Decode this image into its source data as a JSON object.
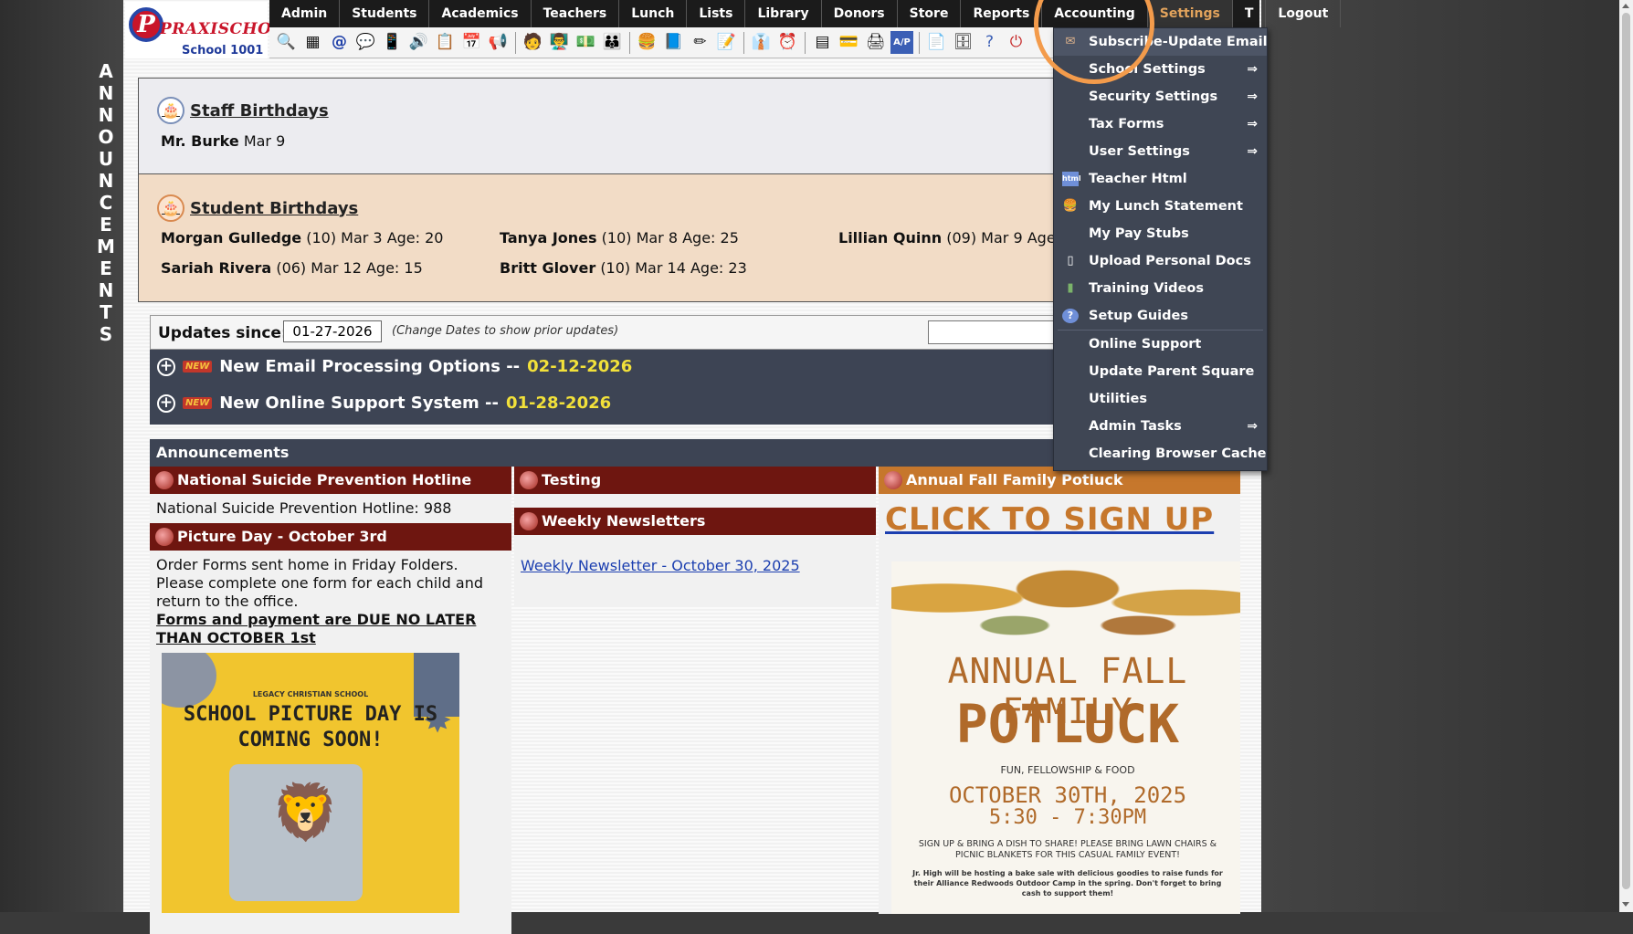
{
  "sidebar_vertical": "ANNOUNCEMENTS",
  "logo": {
    "brand": "PRAXISCHOOL",
    "letter": "P",
    "tm": "™",
    "school": "School 1001"
  },
  "nav": [
    "Admin",
    "Students",
    "Academics",
    "Teachers",
    "Lunch",
    "Lists",
    "Library",
    "Donors",
    "Store",
    "Reports",
    "Accounting",
    "Settings",
    "T",
    "Logout"
  ],
  "toolbar_icons": [
    "magnifier-icon",
    "grid-icon",
    "email-icon",
    "chat-icon",
    "phone-icon",
    "speaker-icon",
    "form-icon",
    "calendar-icon",
    "megaphone-icon",
    "person-icon",
    "teacher-icon",
    "money-icon",
    "parents-icon",
    "lunch-icon",
    "book-icon",
    "pencil-icon",
    "notes-icon",
    "staff-icon",
    "clock-icon",
    "table-icon",
    "card-icon",
    "printer-icon",
    "ap-icon",
    "pdf-icon",
    "server-icon",
    "help-icon",
    "power-icon"
  ],
  "staff_birthdays": {
    "title": "Staff Birthdays",
    "entries": [
      {
        "name": "Mr. Burke",
        "detail": "Mar 9"
      }
    ]
  },
  "student_birthdays": {
    "title": "Student Birthdays",
    "entries": [
      {
        "name": "Morgan Gulledge",
        "detail": "(10) Mar 3 Age: 20"
      },
      {
        "name": "Tanya Jones",
        "detail": "(10) Mar 8 Age: 25"
      },
      {
        "name": "Lillian Quinn",
        "detail": "(09) Mar 9 Age:"
      },
      {
        "name": "Sariah Rivera",
        "detail": "(06) Mar 12 Age: 15"
      },
      {
        "name": "Britt Glover",
        "detail": "(10) Mar 14 Age: 23"
      }
    ]
  },
  "updates": {
    "label": "Updates since:",
    "date": "01-27-2026",
    "hint": "(Change Dates to show prior updates)",
    "new_badge": "NEW",
    "items": [
      {
        "title": "New Email Processing Options --",
        "date": "02-12-2026"
      },
      {
        "title": "New Online Support System --",
        "date": "01-28-2026"
      }
    ]
  },
  "announcements": {
    "header": "Announcements",
    "hotline": {
      "title": "National Suicide Prevention Hotline",
      "body": "National Suicide Prevention Hotline: 988"
    },
    "picture_day": {
      "title": "Picture Day - October 3rd",
      "body": "Order Forms sent home in Friday Folders. Please complete one form for each child and return to the office.",
      "due": "Forms and payment are DUE NO LATER THAN OCTOBER 1st",
      "poster_school": "LEGACY CHRISTIAN SCHOOL",
      "poster_title": "SCHOOL PICTURE DAY IS COMING SOON!"
    },
    "testing": {
      "title": "Testing"
    },
    "newsletters": {
      "title": "Weekly Newsletters",
      "link": "Weekly Newsletter - October 30, 2025"
    },
    "potluck": {
      "title": "Annual Fall Family Potluck",
      "cta": "CLICK TO SIGN UP",
      "poster_title1": "ANNUAL FALL FAMILY",
      "poster_title2": "POTLUCK",
      "poster_sub": "FUN, FELLOWSHIP & FOOD",
      "poster_date": "OCTOBER 30TH, 2025",
      "poster_time": "5:30 - 7:30PM",
      "poster_note1": "SIGN UP & BRING A DISH TO SHARE! PLEASE BRING LAWN CHAIRS & PICNIC BLANKETS FOR THIS CASUAL FAMILY EVENT!",
      "poster_note2": "Jr. High will be hosting a bake sale with delicious goodies to raise funds for their Alliance Redwoods Outdoor Camp in the spring. Don't forget to bring cash to support them!"
    }
  },
  "settings_menu": [
    {
      "label": "Subscribe-Update Email",
      "icon": "envelope-icon",
      "arrow": false
    },
    {
      "label": "School Settings",
      "icon": "",
      "arrow": true
    },
    {
      "label": "Security Settings",
      "icon": "",
      "arrow": true
    },
    {
      "label": "Tax Forms",
      "icon": "",
      "arrow": true
    },
    {
      "label": "User Settings",
      "icon": "",
      "arrow": true
    },
    {
      "label": "Teacher Html",
      "icon": "html-icon",
      "arrow": false
    },
    {
      "label": "My Lunch Statement",
      "icon": "burger-icon",
      "arrow": false
    },
    {
      "label": "My Pay Stubs",
      "icon": "",
      "arrow": false
    },
    {
      "label": "Upload Personal Docs",
      "icon": "document-icon",
      "arrow": false
    },
    {
      "label": "Training Videos",
      "icon": "film-icon",
      "arrow": false
    },
    {
      "label": "Setup Guides",
      "icon": "help-icon",
      "arrow": false
    },
    {
      "label": "Online Support",
      "icon": "",
      "arrow": false
    },
    {
      "label": "Update Parent Square",
      "icon": "",
      "arrow": false
    },
    {
      "label": "Utilities",
      "icon": "",
      "arrow": false
    },
    {
      "label": "Admin Tasks",
      "icon": "",
      "arrow": true
    },
    {
      "label": "Clearing Browser Cache",
      "icon": "",
      "arrow": false
    }
  ],
  "colors": {
    "accent": "#f39b4b",
    "nav_bg": "#1b1b1b",
    "menu_bg": "#3f4654",
    "card_title": "#6e1610",
    "potluck": "#c6772c"
  }
}
